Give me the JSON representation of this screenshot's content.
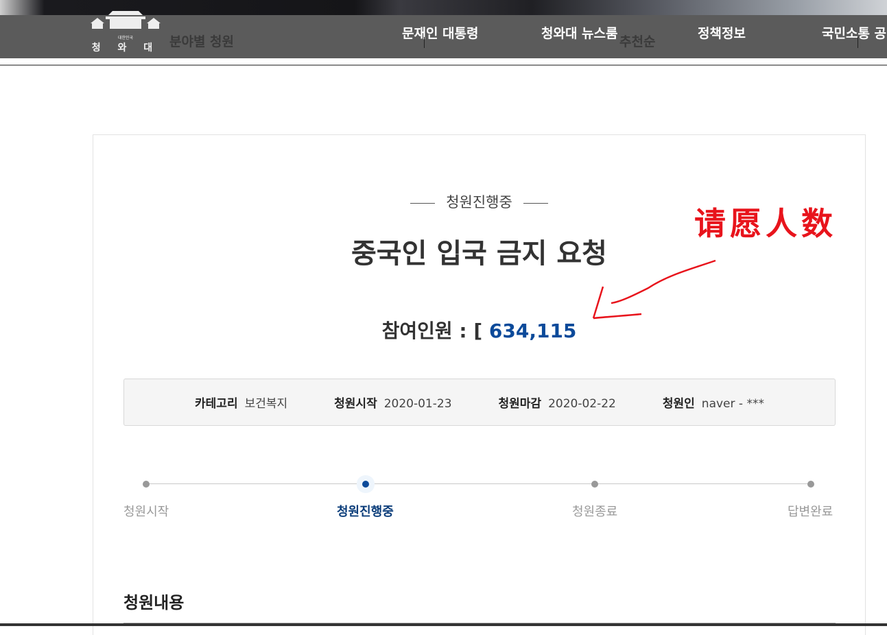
{
  "header": {
    "logo_small": "대한민국",
    "logo_name": "청 와 대",
    "subnav": "분야별 청원",
    "sort": "추천순",
    "menu": [
      "문재인 대통령",
      "청와대 뉴스룸",
      "정책정보",
      "국민소통 공"
    ]
  },
  "petition": {
    "status": "청원진행중",
    "title": "중국인 입국 금지 요청",
    "count_label": "참여인원 : [",
    "count": "634,115",
    "info": [
      {
        "label": "카테고리",
        "value": "보건복지"
      },
      {
        "label": "청원시작",
        "value": "2020-01-23"
      },
      {
        "label": "청원마감",
        "value": "2020-02-22"
      },
      {
        "label": "청원인",
        "value": "naver - ***"
      }
    ],
    "steps": [
      "청원시작",
      "청원진행중",
      "청원종료",
      "답변완료"
    ],
    "active_step": 1,
    "content_heading": "청원내용"
  },
  "annotation": {
    "text": "请愿人数",
    "color": "#e8141c"
  },
  "colors": {
    "accent": "#0b4a9a",
    "nav_bg": "#5b5b5b"
  }
}
